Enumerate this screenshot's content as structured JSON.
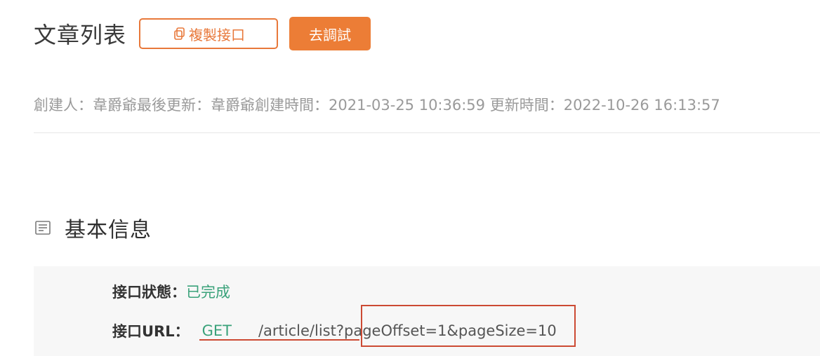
{
  "header": {
    "title": "文章列表",
    "copy_label": "複製接口",
    "debug_label": "去調試"
  },
  "meta": {
    "text": "創建人：韋爵爺最後更新：韋爵爺創建時間：2021-03-25 10:36:59 更新時間：2022-10-26 16:13:57"
  },
  "section": {
    "title": "基本信息"
  },
  "info": {
    "status_label": "接口狀態：",
    "status_value": "已完成",
    "url_label": "接口URL：",
    "method": "GET",
    "path": "/article/list?",
    "query": "pageOffset=1&pageSize=10"
  },
  "icons": {
    "copy": "copy-icon",
    "section": "document-list-icon"
  },
  "colors": {
    "accent": "#e8783a",
    "success": "#3aa27a",
    "annotation": "#cc4a33"
  }
}
